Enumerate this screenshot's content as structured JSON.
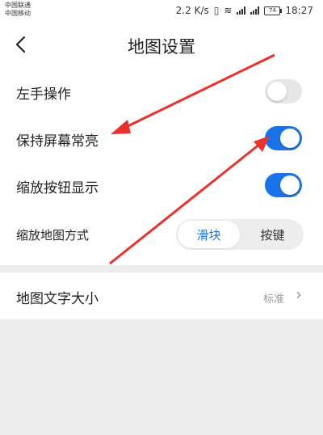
{
  "status_bar": {
    "carrier_1": "中国联通",
    "carrier_2": "中国移动",
    "speed": "2.2 K/s",
    "battery": "74",
    "time": "18:27"
  },
  "header": {
    "back_icon": "chevron-left-icon",
    "title": "地图设置"
  },
  "settings": {
    "left_hand": {
      "label": "左手操作",
      "enabled": false
    },
    "keep_screen_on": {
      "label": "保持屏幕常亮",
      "enabled": true
    },
    "zoom_buttons": {
      "label": "缩放按钮显示",
      "enabled": true
    },
    "zoom_method": {
      "label": "缩放地图方式",
      "options": [
        "滑块",
        "按键"
      ],
      "selected": "滑块"
    },
    "text_size": {
      "label": "地图文字大小",
      "value": "标准"
    }
  },
  "colors": {
    "accent": "#1a73e8",
    "annotation": "#e8322b",
    "background": "#ededed"
  }
}
